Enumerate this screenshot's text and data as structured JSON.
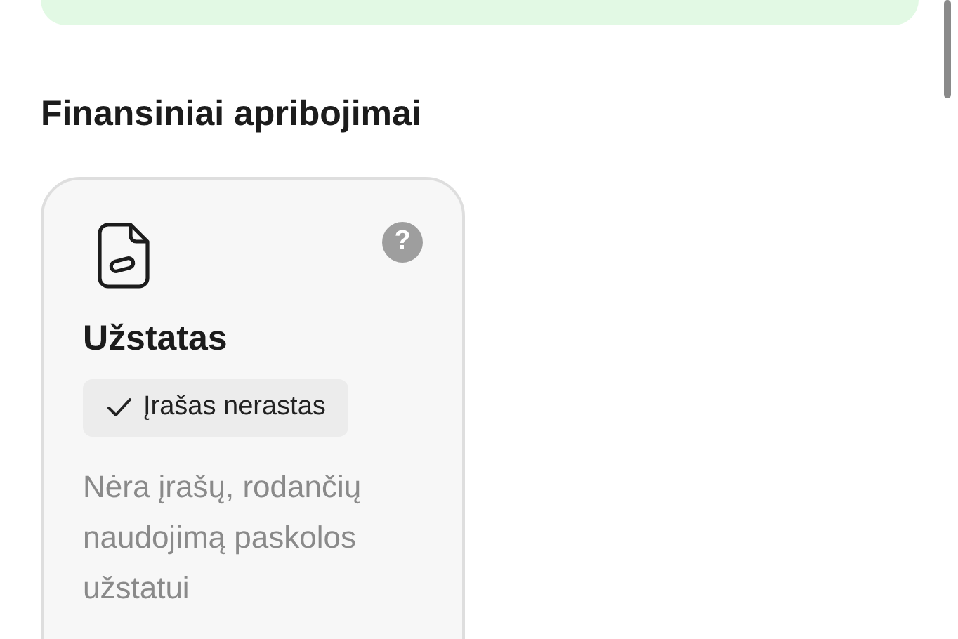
{
  "section": {
    "title": "Finansiniai apribojimai"
  },
  "cards": [
    {
      "title": "Užstatas",
      "status": {
        "kind": "ok",
        "label": "Įrašas nerastas"
      },
      "description": "Nėra įrašų, rodančių naudojimą paskolos užstatui",
      "help": "?"
    }
  ]
}
